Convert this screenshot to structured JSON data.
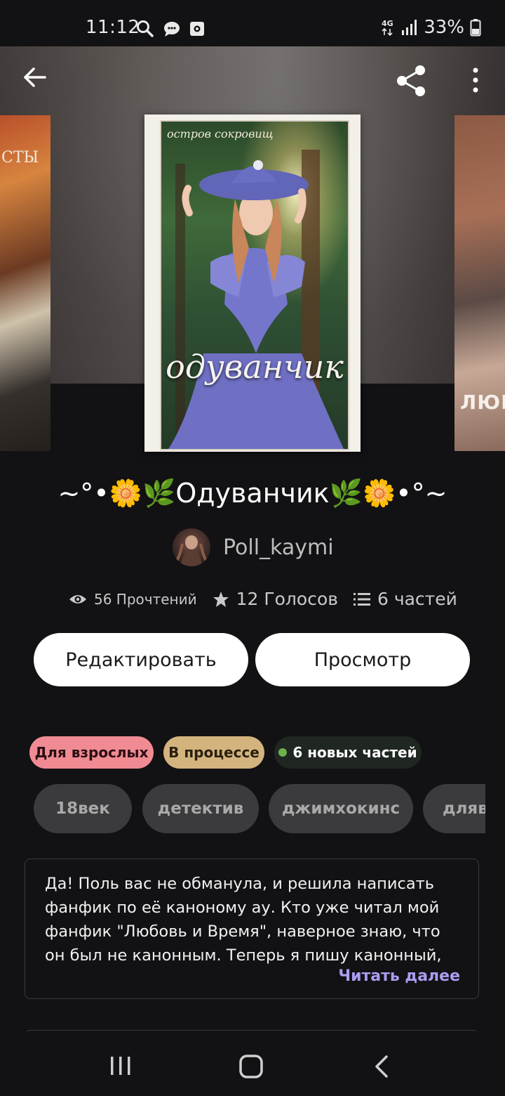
{
  "status_bar": {
    "time": "11:12",
    "battery": "33%",
    "network": "4G"
  },
  "cover": {
    "series_text": "остров сокровищ",
    "title_text": "одуванчик",
    "left_partial_text": "СТЫ",
    "right_partial_text": "ЛЮБ"
  },
  "story": {
    "title": "~°•🌼🌿Одуванчик🌿🌼•°~",
    "author": "Poll_kaymi",
    "reads": "56 Прочтений",
    "votes": "12 Голосов",
    "parts": "6 частей"
  },
  "actions": {
    "edit": "Редактировать",
    "view": "Просмотр"
  },
  "badges": {
    "adult": "Для взрослых",
    "in_progress": "В процессе",
    "new_parts": "6 новых частей",
    "new_color": "#6fb14b"
  },
  "tags": [
    "18век",
    "детектив",
    "джимхокинс",
    "длявзрослых"
  ],
  "description": {
    "text": "Да! Поль вас не обманула, и решила написать фанфик по её каноному ау. Кто уже читал мой фанфик \"Любовь и Время\", наверное знаю, что он был не канонным. Теперь я пишу канонный,",
    "read_more": "Читать далее"
  },
  "colors": {
    "background": "#121114",
    "read_more": "#a99ef0",
    "adult_badge": "#f08b93",
    "progress_badge": "#d4b47e"
  },
  "icons": [
    "back-arrow-icon",
    "share-icon",
    "more-vert-icon",
    "eye-icon",
    "star-icon",
    "list-icon",
    "recents-icon",
    "home-icon",
    "nav-back-icon"
  ]
}
